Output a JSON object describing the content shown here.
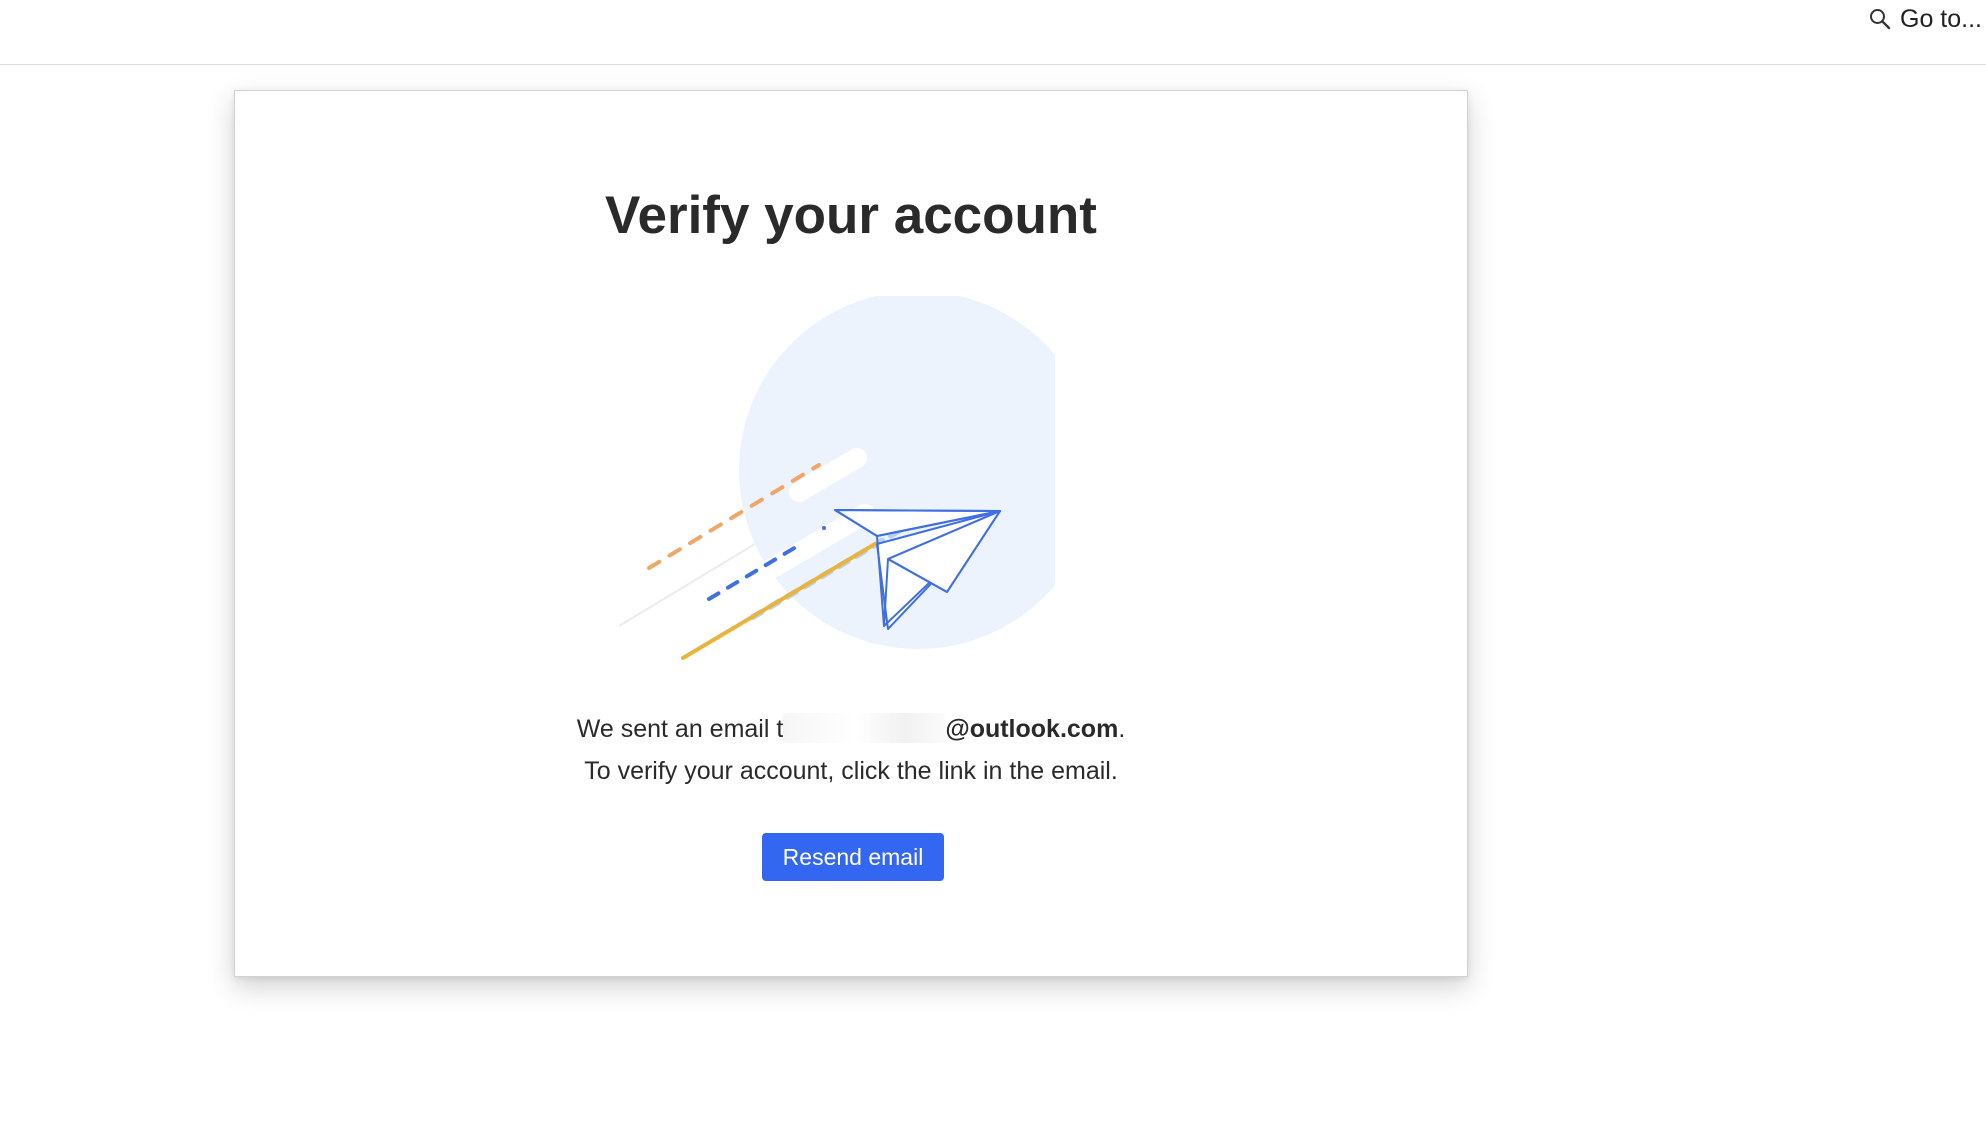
{
  "header": {
    "goto_label": "Go to...",
    "goto_icon": "search-icon"
  },
  "card": {
    "title": "Verify your account",
    "illustration_icon": "paper-plane-icon",
    "message_prefix": "We sent an email t",
    "email_domain": "@outlook.com",
    "message_suffix": ".",
    "instruction": "To verify your account, click the link in the email.",
    "resend_label": "Resend email"
  },
  "colors": {
    "accent": "#3367f2",
    "plane_stroke": "#3f6fe0",
    "circle_fill": "#edf3fd",
    "orange_trail": "#f0a766",
    "gold_trail": "#e8b43a",
    "light_blue_trail": "#b9cff4"
  }
}
